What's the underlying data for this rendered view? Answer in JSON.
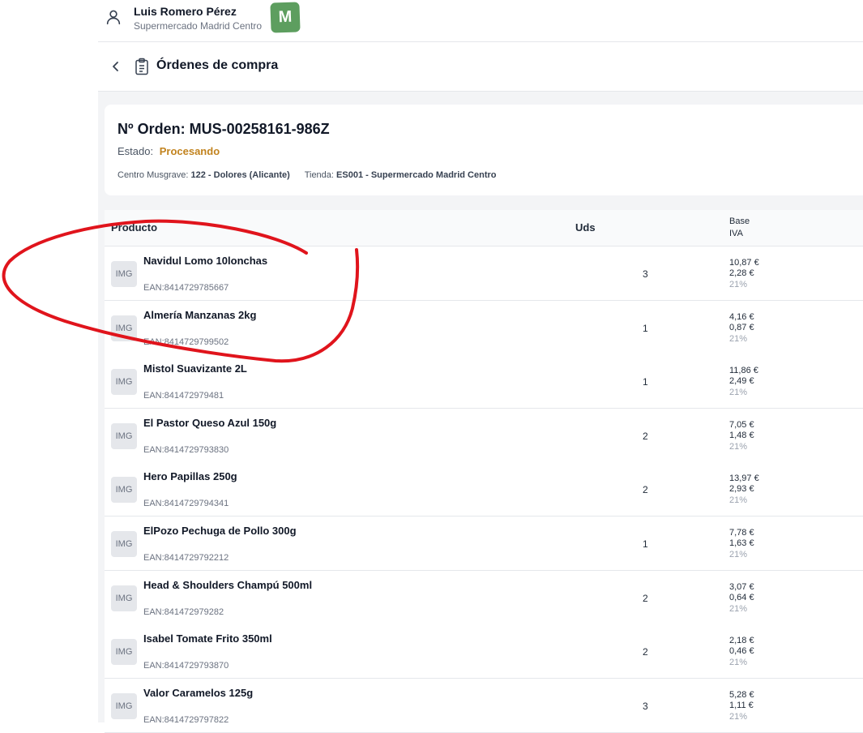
{
  "user": {
    "name": "Luis Romero Pérez",
    "store": "Supermercado Madrid Centro",
    "logo_letter": "M"
  },
  "header": {
    "title": "Órdenes de compra"
  },
  "order": {
    "title": "Nº Orden: MUS-00258161-986Z",
    "status_label": "Estado:",
    "status_value": "Procesando",
    "center_label": "Centro Musgrave:",
    "center_value": "122 - Dolores (Alicante)",
    "store_label": "Tienda:",
    "store_value": "ES001 - Supermercado Madrid Centro"
  },
  "table": {
    "headers": {
      "product": "Producto",
      "units": "Uds",
      "base": "Base",
      "iva": "IVA"
    },
    "rows": [
      {
        "thumb": "IMG",
        "name": "Navidul Lomo 10lonchas",
        "ean": "EAN:8414729785667",
        "qty": "3",
        "base": "10,87 €",
        "iva": "2,28 €",
        "rate": "21%"
      },
      {
        "thumb": "IMG",
        "name": "Almería Manzanas 2kg",
        "ean": "EAN:8414729799502",
        "qty": "1",
        "base": "4,16 €",
        "iva": "0,87 €",
        "rate": "21%"
      },
      {
        "thumb": "IMG",
        "name": "Mistol Suavizante 2L",
        "ean": "EAN:841472979481",
        "qty": "1",
        "base": "11,86 €",
        "iva": "2,49 €",
        "rate": "21%"
      },
      {
        "thumb": "IMG",
        "name": "El Pastor Queso Azul 150g",
        "ean": "EAN:8414729793830",
        "qty": "2",
        "base": "7,05 €",
        "iva": "1,48 €",
        "rate": "21%"
      },
      {
        "thumb": "IMG",
        "name": "Hero Papillas 250g",
        "ean": "EAN:8414729794341",
        "qty": "2",
        "base": "13,97 €",
        "iva": "2,93 €",
        "rate": "21%"
      },
      {
        "thumb": "IMG",
        "name": "ElPozo Pechuga de Pollo 300g",
        "ean": "EAN:8414729792212",
        "qty": "1",
        "base": "7,78 €",
        "iva": "1,63 €",
        "rate": "21%"
      },
      {
        "thumb": "IMG",
        "name": "Head & Shoulders Champú 500ml",
        "ean": "EAN:841472979282",
        "qty": "2",
        "base": "3,07 €",
        "iva": "0,64 €",
        "rate": "21%"
      },
      {
        "thumb": "IMG",
        "name": "Isabel Tomate Frito 350ml",
        "ean": "EAN:8414729793870",
        "qty": "2",
        "base": "2,18 €",
        "iva": "0,46 €",
        "rate": "21%"
      },
      {
        "thumb": "IMG",
        "name": "Valor Caramelos 125g",
        "ean": "EAN:8414729797822",
        "qty": "3",
        "base": "5,28 €",
        "iva": "1,11 €",
        "rate": "21%"
      }
    ]
  },
  "colors": {
    "status": "#c2831e",
    "logo": "#5d9e5f",
    "annotation": "#e0141c"
  }
}
